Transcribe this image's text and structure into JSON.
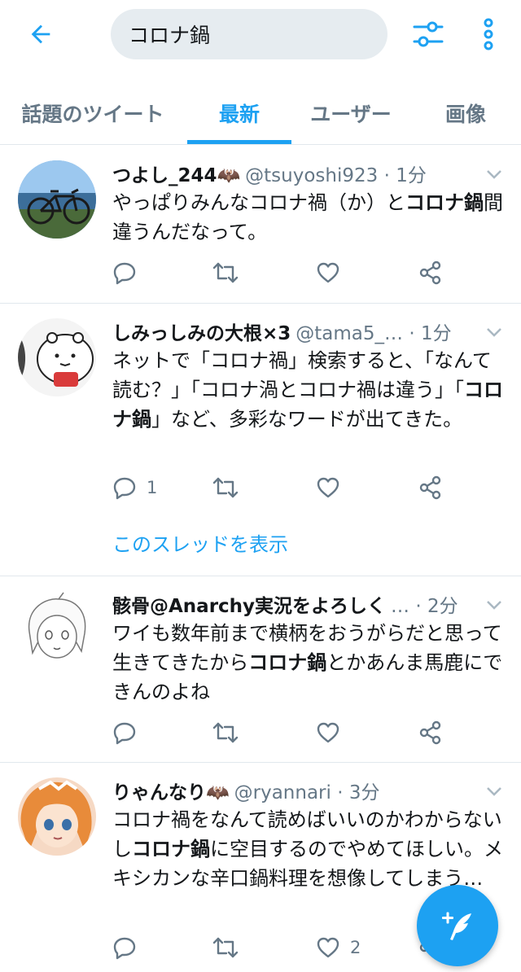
{
  "search": {
    "query": "コロナ鍋"
  },
  "tabs": [
    {
      "label": "話題のツイート"
    },
    {
      "label": "最新"
    },
    {
      "label": "ユーザー"
    },
    {
      "label": "画像"
    }
  ],
  "colors": {
    "accent": "#1da1f2",
    "text": "#14171a",
    "muted": "#657786",
    "divider": "#e1e8ed",
    "search_bg": "#e6ecf0"
  },
  "icons": {
    "back": "back-arrow-icon",
    "filter": "filter-sliders-icon",
    "more": "more-vertical-icon",
    "reply": "reply-icon",
    "retweet": "retweet-icon",
    "like": "heart-icon",
    "share": "share-icon",
    "compose": "compose-tweet-icon"
  },
  "tweets": [
    {
      "name": "つよし_244🦇",
      "handle": "@tsuyoshi923 · 1分",
      "text_before": "やっぱりみんなコロナ禍（か）と",
      "highlight": "コロナ鍋",
      "text_after": "間違うんだなって。",
      "reply_count": "",
      "like_count": ""
    },
    {
      "name": "しみっしみの大根×3",
      "handle": "@tama5_… · 1分",
      "text_before": "ネットで「コロナ禍」検索すると、「なんて読む？」「コロナ渦とコロナ禍は違う」「",
      "highlight": "コロナ鍋",
      "text_after": "」など、多彩なワードが出てきた。",
      "reply_count": "1",
      "like_count": "",
      "thread_link": "このスレッドを表示"
    },
    {
      "name": "骸骨@Anarchy実況をよろしく",
      "handle": "… · 2分",
      "text_before": "ワイも数年前まで横柄をおうがらだと思って生きてきたから",
      "highlight": "コロナ鍋",
      "text_after": "とかあんま馬鹿にできんのよね",
      "reply_count": "",
      "like_count": ""
    },
    {
      "name": "りゃんなり🦇",
      "handle": "@ryannari · 3分",
      "text_before": "コロナ禍をなんて読めばいいのかわからないし",
      "highlight": "コロナ鍋",
      "text_after": "に空目するのでやめてほしい。メキシカンな辛口鍋料理を想像してしまう…",
      "reply_count": "",
      "like_count": "2"
    }
  ]
}
